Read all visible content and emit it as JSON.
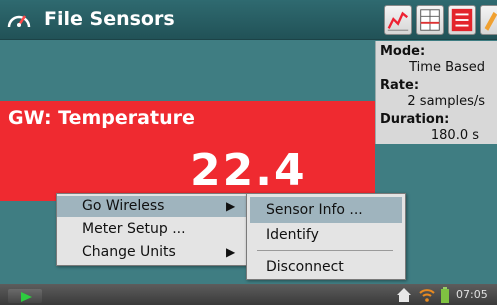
{
  "titlebar": {
    "title": "File  Sensors"
  },
  "info": {
    "mode_label": "Mode:",
    "mode_value": "Time Based",
    "rate_label": "Rate:",
    "rate_value": "2 samples/s",
    "duration_label": "Duration:",
    "duration_value": "180.0 s"
  },
  "meter": {
    "label": "GW: Temperature",
    "value": "22.4 °C"
  },
  "menu": {
    "items": [
      {
        "label": "Go Wireless",
        "has_submenu": true
      },
      {
        "label": "Meter Setup ...",
        "has_submenu": false
      },
      {
        "label": "Change Units",
        "has_submenu": true
      }
    ]
  },
  "submenu": {
    "items": [
      {
        "label": "Sensor Info ..."
      },
      {
        "label": "Identify"
      },
      {
        "label": "Disconnect"
      }
    ]
  },
  "taskbar": {
    "clock": "07:05"
  },
  "colors": {
    "meter_red": "#ef2a30",
    "teal": "#3f7d82",
    "menu_highlight": "#9fb4be"
  },
  "icons": [
    "gauge-icon",
    "graph-view-icon",
    "table-view-icon",
    "list-view-icon",
    "play-icon",
    "home-icon",
    "wifi-icon",
    "battery-icon"
  ]
}
